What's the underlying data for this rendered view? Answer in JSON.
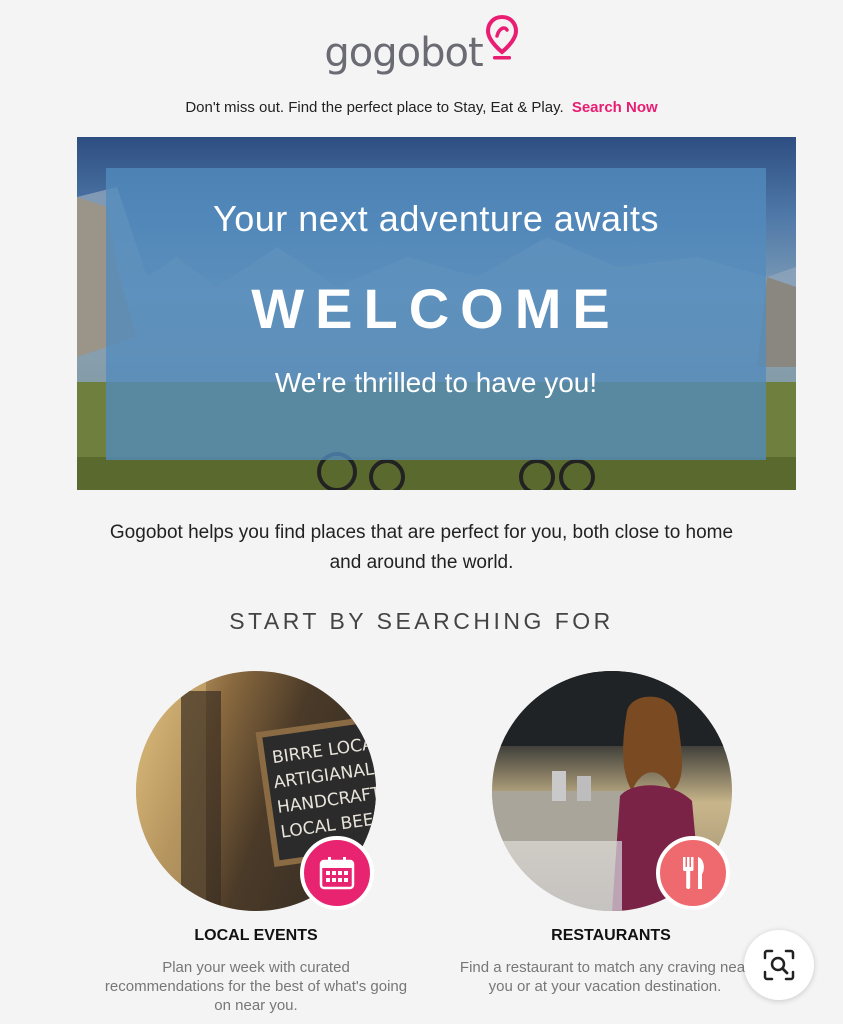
{
  "brand": {
    "name": "gogobot",
    "accent": "#e91e73"
  },
  "tagline": {
    "text": "Don't miss out. Find the perfect place to Stay, Eat & Play.",
    "link": "Search Now"
  },
  "hero": {
    "subtitle": "Your next adventure awaits",
    "title": "WELCOME",
    "bottom": "We're thrilled to have you!"
  },
  "intro": "Gogobot helps you find places that are perfect for you, both close to home and around the world.",
  "section_title": "START BY SEARCHING FOR",
  "cards": [
    {
      "title": "LOCAL EVENTS",
      "description": "Plan your week with curated recommendations for the best of what's going on near you.",
      "icon": "calendar-icon",
      "badge_color": "#e8236f",
      "chalkboard_text": [
        "BIRRE LOCAL",
        "ARTIGIANALI",
        "HANDCRAFT",
        "LOCAL BEER"
      ]
    },
    {
      "title": "RESTAURANTS",
      "description": "Find a restaurant to match any craving near you or at your vacation destination.",
      "icon": "fork-knife-icon",
      "badge_color": "#ef6a6e"
    }
  ],
  "zoom_button": {
    "icon": "visual-search-icon"
  }
}
